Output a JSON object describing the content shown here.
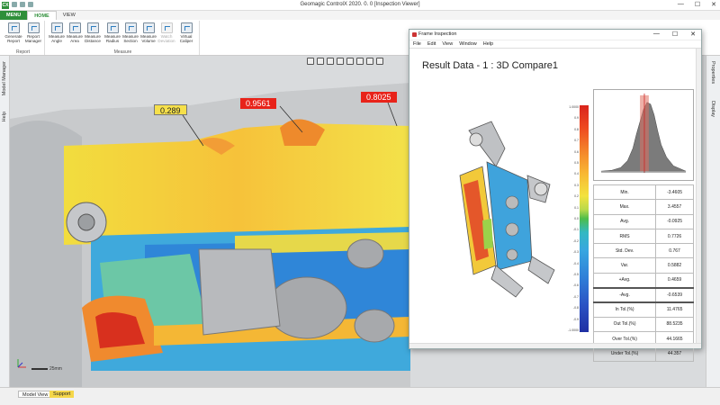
{
  "app": {
    "logo": "CX",
    "title": "Geomagic ControlX 2020. 0. 0  [Inspection Viewer]",
    "window_controls": [
      "—",
      "☐",
      "✕"
    ]
  },
  "ribbon": {
    "tabs": [
      {
        "label": "MENU",
        "kind": "menu"
      },
      {
        "label": "HOME",
        "kind": "active"
      },
      {
        "label": "VIEW",
        "kind": "normal"
      }
    ],
    "groups": [
      {
        "label": "Report",
        "buttons": [
          "Generate Report",
          "Report Manager"
        ]
      },
      {
        "label": "Measure",
        "buttons": [
          "Measure Angle",
          "Measure Area",
          "Measure Distance",
          "Measure Radius",
          "Measure Section",
          "Measure Volume",
          "Watch Deviation",
          "Virtual Caliper"
        ]
      }
    ]
  },
  "left_dock": {
    "tabs": [
      "Model Manager",
      "Help"
    ]
  },
  "right_dock": {
    "tabs": [
      "Properties",
      "Display"
    ]
  },
  "viewport": {
    "callouts": [
      {
        "value": "0.289",
        "color": "yellow"
      },
      {
        "value": "0.9561",
        "color": "red"
      },
      {
        "value": "0.8025",
        "color": "red"
      }
    ],
    "scale_label": "25mm"
  },
  "status": {
    "tabs": [
      "Model View",
      "Support"
    ]
  },
  "frame_inspection": {
    "title": "Frame Inspection",
    "window_controls": [
      "—",
      "☐",
      "✕"
    ],
    "menu": [
      "File",
      "Edit",
      "View",
      "Window",
      "Help"
    ],
    "heading": "Result Data - 1  :   3D Compare1",
    "colorbar": {
      "labels": [
        "1.0000",
        "0.9",
        "0.8",
        "0.7",
        "0.6",
        "0.5",
        "0.4",
        "0.3",
        "0.2",
        "0.1",
        "0.0",
        "-0.1",
        "-0.2",
        "-0.3",
        "-0.4",
        "-0.5",
        "-0.6",
        "-0.7",
        "-0.8",
        "-0.9",
        "-1.0000"
      ],
      "colors": [
        "#d9241c",
        "#1f2fa3"
      ]
    },
    "stats": [
      {
        "label": "Min.",
        "value": "-3.4605"
      },
      {
        "label": "Max.",
        "value": "3.4557"
      },
      {
        "label": "Avg.",
        "value": "-0.0925"
      },
      {
        "label": "RMS",
        "value": "0.7726"
      },
      {
        "label": "Std. Dev.",
        "value": "0.767"
      },
      {
        "label": "Var.",
        "value": "0.5882"
      },
      {
        "label": "+Avg.",
        "value": "0.4659"
      },
      {
        "label": "-Avg.",
        "value": "-0.6539"
      },
      {
        "label": "In Tol.(%)",
        "value": "11.4765"
      },
      {
        "label": "Out Tol.(%)",
        "value": "88.5235"
      },
      {
        "label": "Over Tol.(%)",
        "value": "44.1665"
      },
      {
        "label": "Under Tol.(%)",
        "value": "44.357"
      }
    ]
  }
}
